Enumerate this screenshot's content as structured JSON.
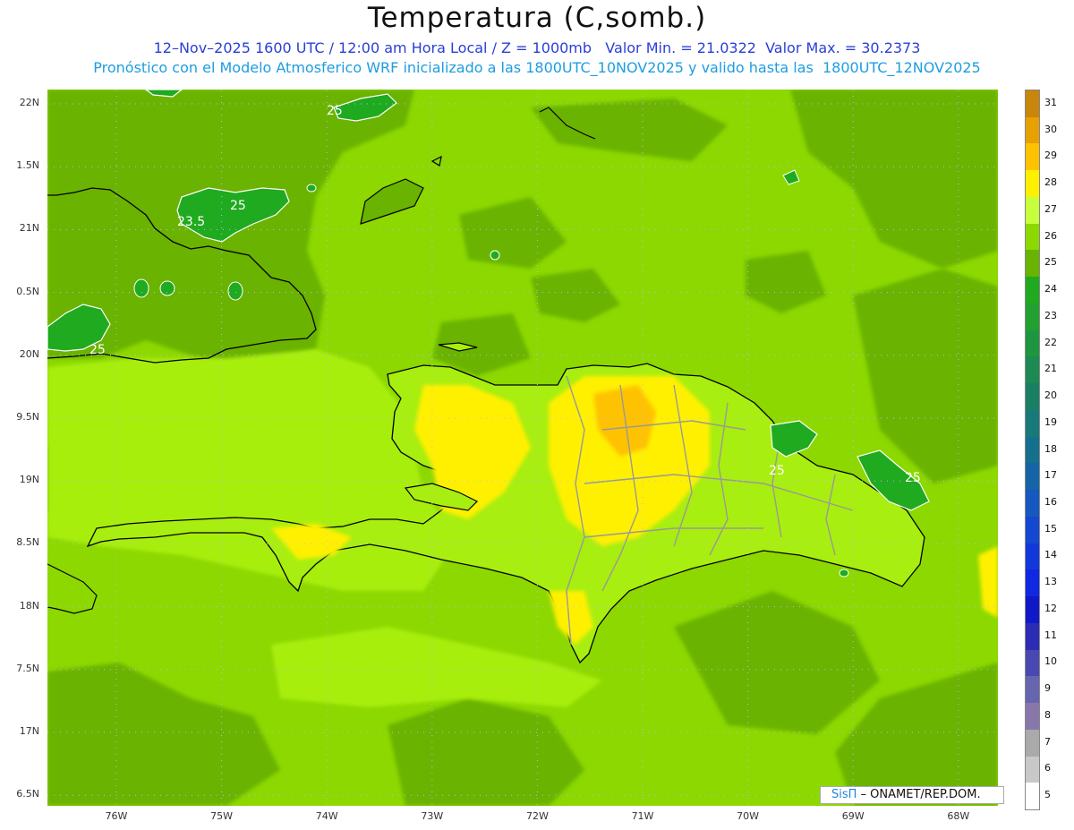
{
  "title": "Temperatura (C,somb.)",
  "subtitle_line1": "12–Nov–2025 1600 UTC / 12:00 am Hora Local / Z = 1000mb   Valor Min. = 21.0322  Valor Max. = 30.2373",
  "subtitle_line2": "Pronóstico con el Modelo Atmosferico WRF inicializado a las 1800UTC_10NOV2025 y valido hasta las  1800UTC_12NOV2025",
  "lat_labels": [
    "22N",
    "1.5N",
    "21N",
    "0.5N",
    "20N",
    "9.5N",
    "19N",
    "8.5N",
    "18N",
    "7.5N",
    "17N",
    "6.5N"
  ],
  "lon_labels": [
    "76W",
    "75W",
    "74W",
    "73W",
    "72W",
    "71W",
    "70W",
    "69W",
    "68W"
  ],
  "colorbar": {
    "labels": [
      "31",
      "30",
      "29",
      "28",
      "27",
      "26",
      "25",
      "24",
      "23",
      "22",
      "21",
      "20",
      "19",
      "18",
      "17",
      "16",
      "15",
      "14",
      "13",
      "12",
      "11",
      "10",
      "9",
      "8",
      "7",
      "6",
      "5"
    ],
    "colors": [
      "#c8860a",
      "#e6a000",
      "#ffc200",
      "#fff000",
      "#c8ff3c",
      "#8cd800",
      "#6ab300",
      "#1faa1f",
      "#22a030",
      "#1e9640",
      "#1c8a52",
      "#1a8064",
      "#187a78",
      "#14708c",
      "#1464a6",
      "#1458c0",
      "#1448d0",
      "#1238dc",
      "#1028e0",
      "#1018c8",
      "#2c2cb4",
      "#4848b0",
      "#6666b0",
      "#8877aa",
      "#aaaaaa",
      "#c8c8c8",
      "#ffffff"
    ]
  },
  "contour_labels": [
    {
      "text": "25"
    },
    {
      "text": "25"
    },
    {
      "text": "23.5"
    },
    {
      "text": "25"
    },
    {
      "text": "25"
    },
    {
      "text": "25"
    }
  ],
  "credit": {
    "sis": "SisΠ",
    "rest": " – ONAMET/REP.DOM."
  }
}
